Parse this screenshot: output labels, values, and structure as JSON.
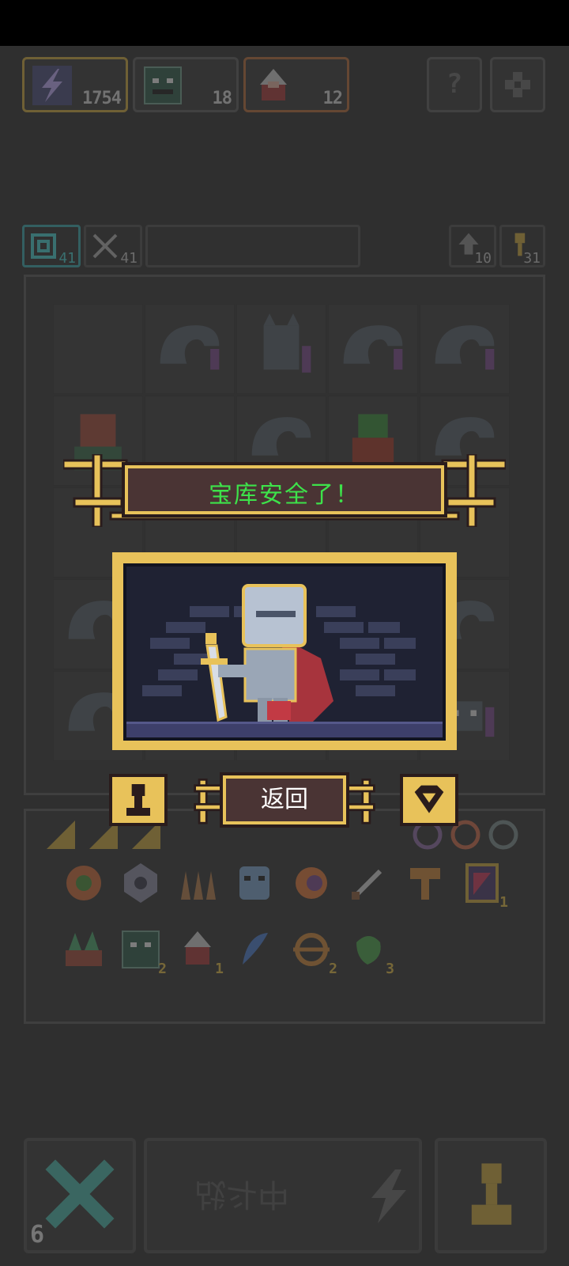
{
  "resources": [
    {
      "name": "energy",
      "icon": "lightning-icon",
      "count": "1754"
    },
    {
      "name": "monster-cards",
      "icon": "monster-card-icon",
      "count": "18"
    },
    {
      "name": "hero-cards",
      "icon": "hero-card-icon",
      "count": "12"
    }
  ],
  "top_buttons": {
    "help": "?",
    "settings": "gear"
  },
  "secondary": {
    "left_counts": [
      "41",
      "41"
    ],
    "right_counts": [
      "10",
      "31"
    ]
  },
  "inventory": {
    "row1": [
      {
        "icon": "clover-coin-icon",
        "count": ""
      },
      {
        "icon": "gear-emblem-icon",
        "count": ""
      },
      {
        "icon": "spike-trap-icon",
        "count": ""
      },
      {
        "icon": "mask-icon",
        "count": ""
      },
      {
        "icon": "shell-icon",
        "count": ""
      },
      {
        "icon": "dagger-icon",
        "count": ""
      },
      {
        "icon": "hammer-icon",
        "count": ""
      },
      {
        "icon": "potion-scroll-icon",
        "count": "1"
      }
    ],
    "row2": [
      {
        "icon": "bramble-icon",
        "count": ""
      },
      {
        "icon": "monster-card-icon",
        "count": "2"
      },
      {
        "icon": "hero-card-icon",
        "count": "1"
      },
      {
        "icon": "blue-feather-icon",
        "count": ""
      },
      {
        "icon": "ring-icon",
        "count": "2"
      },
      {
        "icon": "green-charm-icon",
        "count": "3"
      }
    ]
  },
  "bottom": {
    "left_count": "6",
    "battle_label": "战斗中"
  },
  "popup": {
    "title": "宝库安全了！",
    "return_label": "返回"
  },
  "colors": {
    "gold": "#e8c25a",
    "banner_bg": "#4a3434",
    "title_green": "#3de24a",
    "background": "#2f2f2f"
  }
}
